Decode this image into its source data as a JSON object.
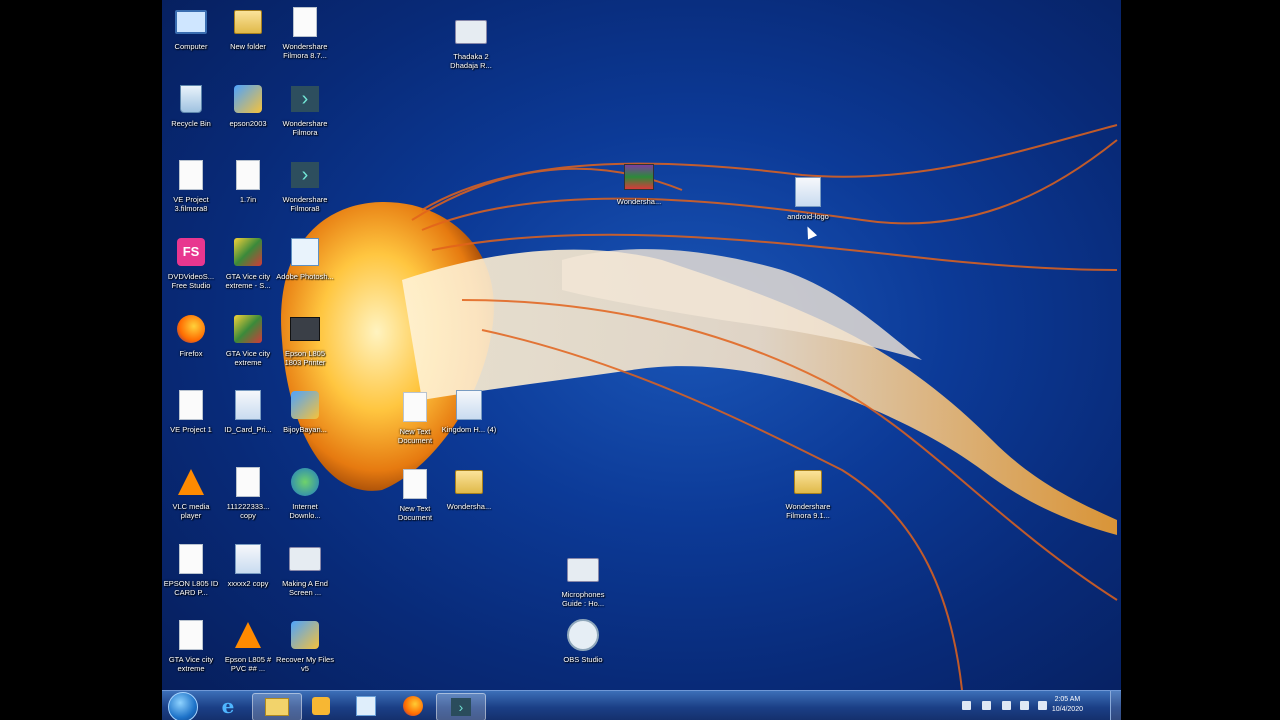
{
  "desktop": {
    "icons": [
      {
        "label": "Computer",
        "icon": "computer-icon"
      },
      {
        "label": "New folder",
        "icon": "folder-icon"
      },
      {
        "label": "Wondershare Filmora 8.7...",
        "icon": "file-icon"
      },
      {
        "label": "Thadaka 2 Dhadaja R...",
        "icon": "video-icon"
      },
      {
        "label": "Recycle Bin",
        "icon": "recycle-bin-icon"
      },
      {
        "label": "epson2003",
        "icon": "app-icon"
      },
      {
        "label": "Wondershare Filmora",
        "icon": "filmora-icon"
      },
      {
        "label": "VE Project 3.filmora8",
        "icon": "file-icon"
      },
      {
        "label": "1.7in",
        "icon": "file-icon"
      },
      {
        "label": "Wondershare Filmora8",
        "icon": "filmora-icon"
      },
      {
        "label": "Wondersha...",
        "icon": "archive-icon"
      },
      {
        "label": "android-logo",
        "icon": "image-icon"
      },
      {
        "label": "DVDVideoS... Free Studio",
        "icon": "dvdvideosoft-icon"
      },
      {
        "label": "GTA Vice city extreme - S...",
        "icon": "game-icon"
      },
      {
        "label": "Adobe Photosh...",
        "icon": "photoshop-icon"
      },
      {
        "label": "Firefox",
        "icon": "firefox-icon"
      },
      {
        "label": "GTA Vice city extreme",
        "icon": "game-icon"
      },
      {
        "label": "Epson L805 1803 Printer",
        "icon": "printer-icon"
      },
      {
        "label": "VE Project 1",
        "icon": "file-icon"
      },
      {
        "label": "ID_Card_Pri...",
        "icon": "image-icon"
      },
      {
        "label": "BijoyBayan...",
        "icon": "app-icon"
      },
      {
        "label": "New Text Document",
        "icon": "text-file-icon"
      },
      {
        "label": "Kingdom H... (4)",
        "icon": "image-icon"
      },
      {
        "label": "VLC media player",
        "icon": "vlc-icon"
      },
      {
        "label": "111222333... copy",
        "icon": "file-icon"
      },
      {
        "label": "Internet Downlo...",
        "icon": "idm-icon"
      },
      {
        "label": "New Text Document",
        "icon": "text-file-icon"
      },
      {
        "label": "Wondersha...",
        "icon": "folder-icon"
      },
      {
        "label": "Wondershare Filmora 9.1...",
        "icon": "folder-icon"
      },
      {
        "label": "EPSON L805 ID CARD P...",
        "icon": "file-icon"
      },
      {
        "label": "xxxxx2 copy",
        "icon": "image-icon"
      },
      {
        "label": "Making A End Screen ...",
        "icon": "video-icon"
      },
      {
        "label": "Microphones Guide : Ho...",
        "icon": "video-icon"
      },
      {
        "label": "GTA Vice city extreme",
        "icon": "file-icon"
      },
      {
        "label": "Epson L805 # PVC ## ...",
        "icon": "vlc-icon"
      },
      {
        "label": "Recover My Files v5",
        "icon": "app-icon"
      },
      {
        "label": "OBS Studio",
        "icon": "obs-icon"
      }
    ]
  },
  "taskbar": {
    "start_icon": "windows-start-icon",
    "pinned": [
      {
        "icon": "internet-explorer-icon"
      },
      {
        "icon": "windows-explorer-icon"
      },
      {
        "icon": "windows-media-icon"
      },
      {
        "icon": "image-viewer-icon"
      },
      {
        "icon": "firefox-icon"
      },
      {
        "icon": "filmora-icon"
      }
    ],
    "clock_time": "2:05 AM",
    "clock_date": "10/4/2020"
  },
  "colors": {
    "desktop_blue": "#0c3a97",
    "taskbar": "#1b3f86",
    "jellyfish_orange": "#f08a1e"
  }
}
